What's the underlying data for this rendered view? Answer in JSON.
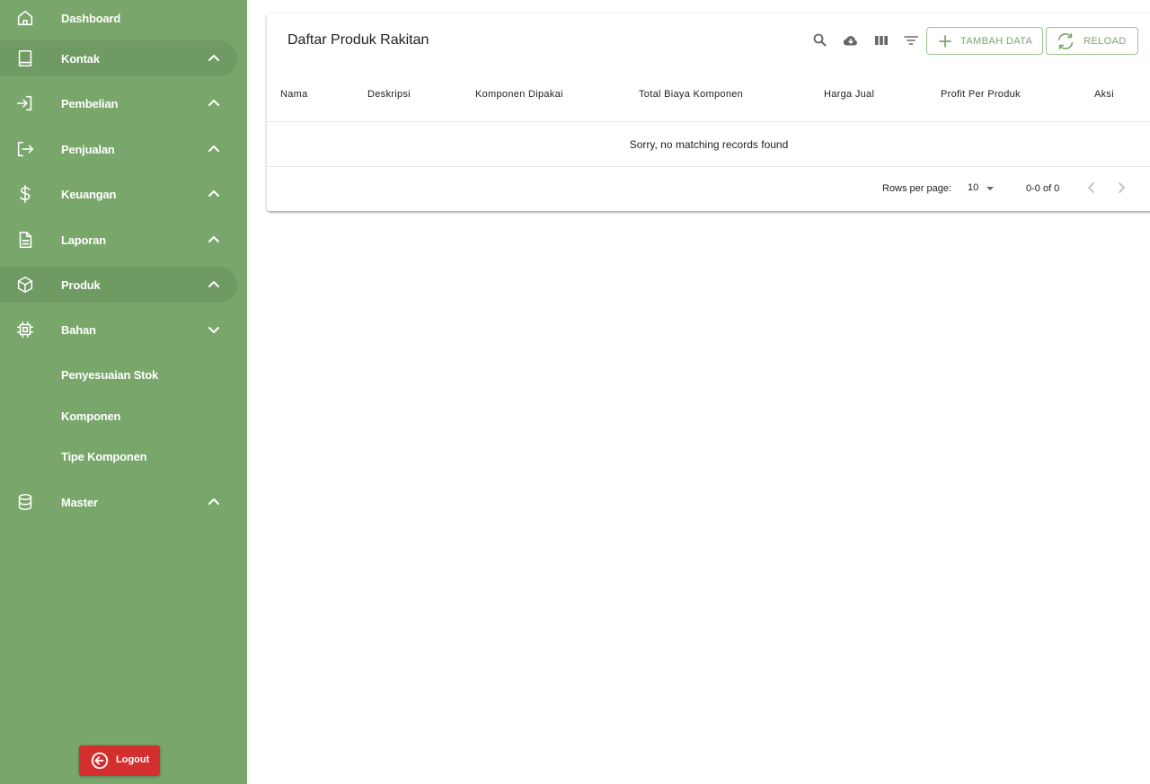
{
  "sidebar": {
    "items": [
      {
        "label": "Dashboard",
        "icon": "home-icon"
      },
      {
        "label": "Kontak",
        "icon": "book-icon"
      },
      {
        "label": "Pembelian",
        "icon": "login-icon"
      },
      {
        "label": "Penjualan",
        "icon": "logout-arrow-icon"
      },
      {
        "label": "Keuangan",
        "icon": "dollar-icon"
      },
      {
        "label": "Laporan",
        "icon": "document-icon"
      },
      {
        "label": "Produk",
        "icon": "box-icon"
      },
      {
        "label": "Bahan",
        "icon": "chip-icon"
      },
      {
        "label": "Master",
        "icon": "database-icon"
      }
    ],
    "subitems": [
      {
        "label": "Penyesuaian Stok"
      },
      {
        "label": "Komponen"
      },
      {
        "label": "Tipe Komponen"
      }
    ],
    "logout_label": "Logout"
  },
  "card": {
    "title": "Daftar Produk Rakitan",
    "add_button": "TAMBAH DATA",
    "reload_button": "RELOAD",
    "columns": [
      "Nama",
      "Deskripsi",
      "Komponen Dipakai",
      "Total Biaya Komponen",
      "Harga Jual",
      "Profit Per Produk",
      "Aksi"
    ],
    "empty_message": "Sorry, no matching records found",
    "rows_per_page_label": "Rows per page:",
    "rows_per_page_value": "10",
    "pagination_text": "0-0 of 0"
  },
  "colors": {
    "sidebar_bg": "#79a66b",
    "accent": "#79a66b",
    "logout_bg": "#d32f2f"
  }
}
